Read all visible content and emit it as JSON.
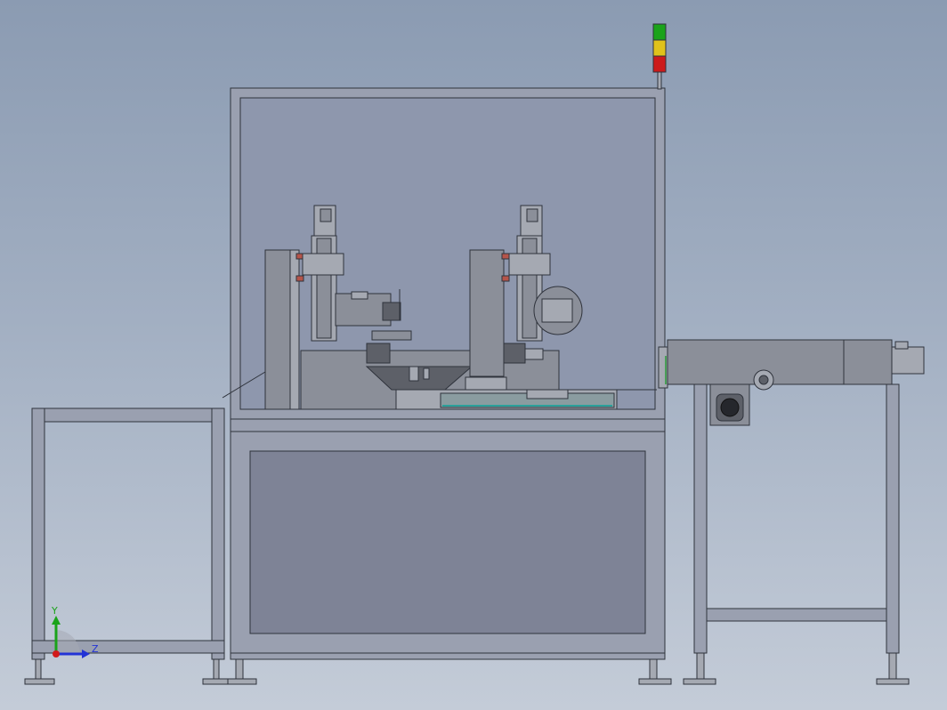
{
  "scene": {
    "description_visible_text": "",
    "triad": {
      "y_label": "Y",
      "z_label": "Z",
      "y_color": "#1aa31a",
      "z_color": "#2333d6",
      "origin_color": "#d11a1a"
    },
    "stack_light": {
      "colors": [
        "#1aa31a",
        "#e0c21a",
        "#cc1a1a"
      ]
    },
    "palette": {
      "frame": "#8f96a8",
      "frame_dark": "#3a3f4a",
      "panel": "#7e8396",
      "glass": "#8e97ad",
      "machine": "#8a8e98"
    }
  }
}
